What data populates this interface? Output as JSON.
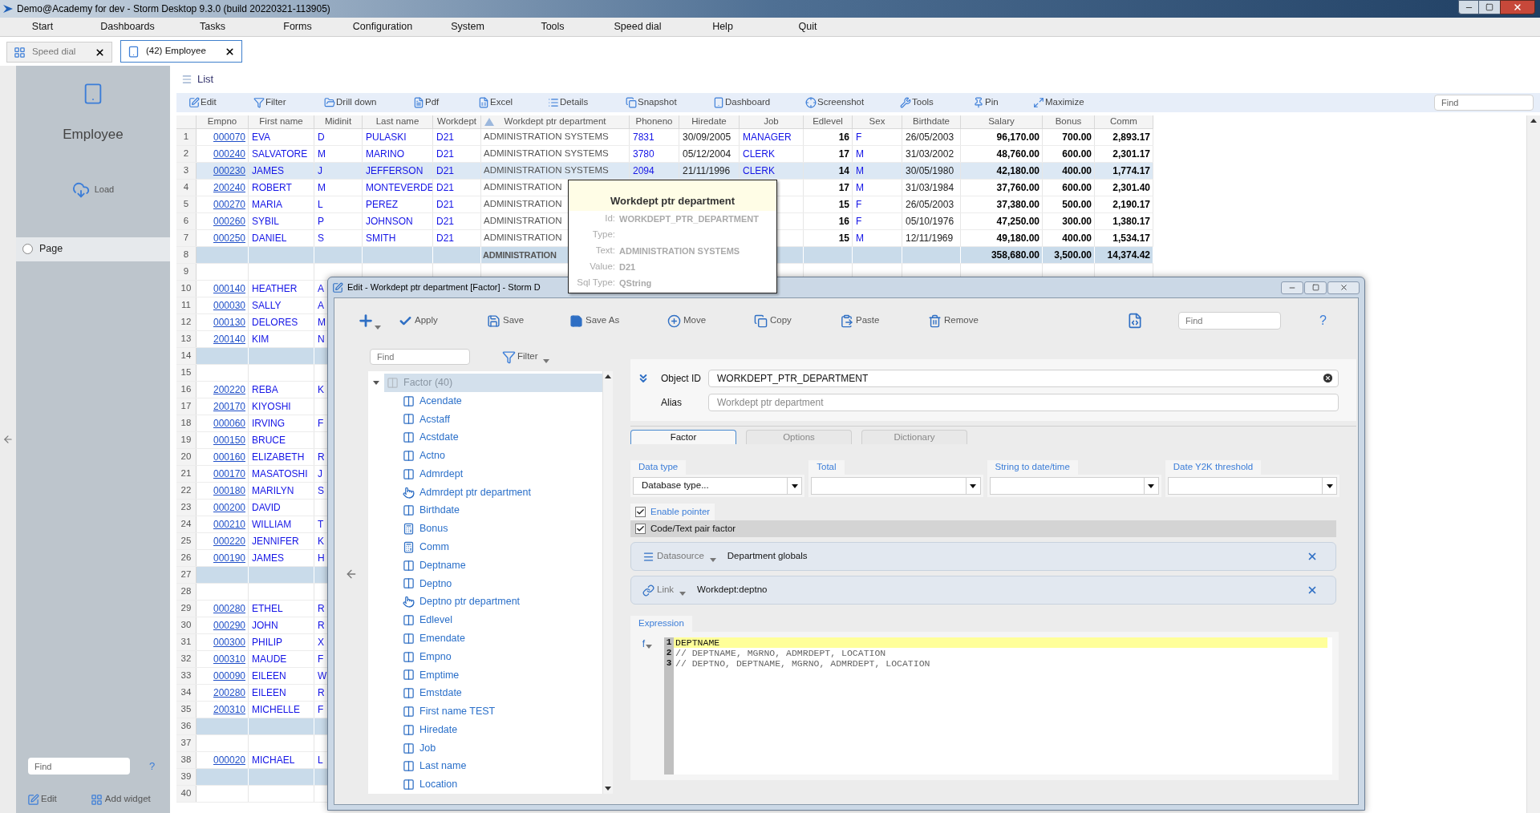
{
  "window": {
    "title": "Demo@Academy for dev -  Storm Desktop 9.3.0 (build 20220321-113905)"
  },
  "menu": [
    "Start",
    "Dashboards",
    "Tasks",
    "Forms",
    "Configuration",
    "System",
    "Tools",
    "Speed dial",
    "Help",
    "Quit"
  ],
  "tabs": [
    {
      "label": "Speed dial",
      "selected": false
    },
    {
      "label": "(42) Employee",
      "selected": true
    }
  ],
  "sidebar": {
    "title": "Employee",
    "load": "Load",
    "items": [
      {
        "label": "Page",
        "selected": false
      }
    ],
    "find_placeholder": "Find",
    "help": "?",
    "actions": [
      "Edit",
      "Add widget"
    ]
  },
  "list": {
    "title": "List",
    "toolbar": [
      "Edit",
      "Filter",
      "Drill down",
      "Pdf",
      "Excel",
      "Details",
      "Snapshot",
      "Dashboard",
      "Screenshot",
      "Tools",
      "Pin",
      "Maximize"
    ],
    "find_placeholder": "Find"
  },
  "table": {
    "columns": [
      {
        "label": "Empno",
        "sorted": false
      },
      {
        "label": "First name",
        "sorted": false
      },
      {
        "label": "Midinit",
        "sorted": false
      },
      {
        "label": "Last name",
        "sorted": false
      },
      {
        "label": "Workdept",
        "sorted": false
      },
      {
        "label": "Workdept ptr department",
        "sorted": true
      },
      {
        "label": "Phoneno",
        "sorted": false
      },
      {
        "label": "Hiredate",
        "sorted": false
      },
      {
        "label": "Job",
        "sorted": false
      },
      {
        "label": "Edlevel",
        "sorted": false
      },
      {
        "label": "Sex",
        "sorted": false
      },
      {
        "label": "Birthdate",
        "sorted": false
      },
      {
        "label": "Salary",
        "sorted": false
      },
      {
        "label": "Bonus",
        "sorted": false
      },
      {
        "label": "Comm",
        "sorted": false
      }
    ],
    "rows": [
      {
        "num": "1",
        "kind": "data",
        "selected": false,
        "cells": {
          "empno": "000070",
          "first_name": "EVA",
          "midinit": "D",
          "last_name": "PULASKI",
          "workdept": "D21",
          "ptr_dept": "ADMINISTRATION SYSTEMS",
          "phoneno": "7831",
          "hiredate": "30/09/2005",
          "job": "MANAGER",
          "edlevel": "16",
          "sex": "F",
          "birthdate": "26/05/2003",
          "salary": "96,170.00",
          "bonus": "700.00",
          "comm": "2,893.17"
        }
      },
      {
        "num": "2",
        "kind": "data",
        "selected": false,
        "cells": {
          "empno": "000240",
          "first_name": "SALVATORE",
          "midinit": "M",
          "last_name": "MARINO",
          "workdept": "D21",
          "ptr_dept": "ADMINISTRATION SYSTEMS",
          "phoneno": "3780",
          "hiredate": "05/12/2004",
          "job": "CLERK",
          "edlevel": "17",
          "sex": "M",
          "birthdate": "31/03/2002",
          "salary": "48,760.00",
          "bonus": "600.00",
          "comm": "2,301.17"
        }
      },
      {
        "num": "3",
        "kind": "data",
        "selected": true,
        "cells": {
          "empno": "000230",
          "first_name": "JAMES",
          "midinit": "J",
          "last_name": "JEFFERSON",
          "workdept": "D21",
          "ptr_dept": "ADMINISTRATION SYSTEMS",
          "phoneno": "2094",
          "hiredate": "21/11/1996",
          "job": "CLERK",
          "edlevel": "14",
          "sex": "M",
          "birthdate": "30/05/1980",
          "salary": "42,180.00",
          "bonus": "400.00",
          "comm": "1,774.17"
        }
      },
      {
        "num": "4",
        "kind": "data",
        "selected": false,
        "cells": {
          "empno": "200240",
          "first_name": "ROBERT",
          "midinit": "M",
          "last_name": "MONTEVERDE",
          "workdept": "D21",
          "ptr_dept": "ADMINISTRATION",
          "edlevel": "17",
          "sex": "M",
          "birthdate": "31/03/1984",
          "salary": "37,760.00",
          "bonus": "600.00",
          "comm": "2,301.40"
        }
      },
      {
        "num": "5",
        "kind": "data",
        "selected": false,
        "cells": {
          "empno": "000270",
          "first_name": "MARIA",
          "midinit": "L",
          "last_name": "PEREZ",
          "workdept": "D21",
          "ptr_dept": "ADMINISTRATION",
          "edlevel": "15",
          "sex": "F",
          "birthdate": "26/05/2003",
          "salary": "37,380.00",
          "bonus": "500.00",
          "comm": "2,190.17"
        }
      },
      {
        "num": "6",
        "kind": "data",
        "selected": false,
        "cells": {
          "empno": "000260",
          "first_name": "SYBIL",
          "midinit": "P",
          "last_name": "JOHNSON",
          "workdept": "D21",
          "ptr_dept": "ADMINISTRATION",
          "edlevel": "16",
          "sex": "F",
          "birthdate": "05/10/1976",
          "salary": "47,250.00",
          "bonus": "300.00",
          "comm": "1,380.17"
        }
      },
      {
        "num": "7",
        "kind": "data",
        "selected": false,
        "cells": {
          "empno": "000250",
          "first_name": "DANIEL",
          "midinit": "S",
          "last_name": "SMITH",
          "workdept": "D21",
          "ptr_dept": "ADMINISTRATION",
          "edlevel": "15",
          "sex": "M",
          "birthdate": "12/11/1969",
          "salary": "49,180.00",
          "bonus": "400.00",
          "comm": "1,534.17"
        }
      },
      {
        "num": "8",
        "kind": "group",
        "selected": false,
        "cells": {
          "ptr_dept": "ADMINISTRATION",
          "salary": "358,680.00",
          "bonus": "3,500.00",
          "comm": "14,374.42"
        }
      },
      {
        "num": "9",
        "kind": "blank",
        "selected": false
      },
      {
        "num": "10",
        "kind": "data",
        "selected": false,
        "cells": {
          "empno": "000140",
          "first_name": "HEATHER",
          "midinit": "A"
        }
      },
      {
        "num": "11",
        "kind": "data",
        "selected": false,
        "cells": {
          "empno": "000030",
          "first_name": "SALLY",
          "midinit": "A"
        }
      },
      {
        "num": "12",
        "kind": "data",
        "selected": false,
        "cells": {
          "empno": "000130",
          "first_name": "DELORES",
          "midinit": "M"
        }
      },
      {
        "num": "13",
        "kind": "data",
        "selected": false,
        "cells": {
          "empno": "200140",
          "first_name": "KIM",
          "midinit": "N"
        }
      },
      {
        "num": "14",
        "kind": "group",
        "selected": false
      },
      {
        "num": "15",
        "kind": "blank",
        "selected": false
      },
      {
        "num": "16",
        "kind": "data",
        "selected": false,
        "cells": {
          "empno": "200220",
          "first_name": "REBA",
          "midinit": "K"
        }
      },
      {
        "num": "17",
        "kind": "data",
        "selected": false,
        "cells": {
          "empno": "200170",
          "first_name": "KIYOSHI"
        }
      },
      {
        "num": "18",
        "kind": "data",
        "selected": false,
        "cells": {
          "empno": "000060",
          "first_name": "IRVING",
          "midinit": "F"
        }
      },
      {
        "num": "19",
        "kind": "data",
        "selected": false,
        "cells": {
          "empno": "000150",
          "first_name": "BRUCE"
        }
      },
      {
        "num": "20",
        "kind": "data",
        "selected": false,
        "cells": {
          "empno": "000160",
          "first_name": "ELIZABETH",
          "midinit": "R"
        }
      },
      {
        "num": "21",
        "kind": "data",
        "selected": false,
        "cells": {
          "empno": "000170",
          "first_name": "MASATOSHI",
          "midinit": "J"
        }
      },
      {
        "num": "22",
        "kind": "data",
        "selected": false,
        "cells": {
          "empno": "000180",
          "first_name": "MARILYN",
          "midinit": "S"
        }
      },
      {
        "num": "23",
        "kind": "data",
        "selected": false,
        "cells": {
          "empno": "000200",
          "first_name": "DAVID"
        }
      },
      {
        "num": "24",
        "kind": "data",
        "selected": false,
        "cells": {
          "empno": "000210",
          "first_name": "WILLIAM",
          "midinit": "T"
        }
      },
      {
        "num": "25",
        "kind": "data",
        "selected": false,
        "cells": {
          "empno": "000220",
          "first_name": "JENNIFER",
          "midinit": "K"
        }
      },
      {
        "num": "26",
        "kind": "data",
        "selected": false,
        "cells": {
          "empno": "000190",
          "first_name": "JAMES",
          "midinit": "H"
        }
      },
      {
        "num": "27",
        "kind": "group",
        "selected": false
      },
      {
        "num": "28",
        "kind": "blank",
        "selected": false
      },
      {
        "num": "29",
        "kind": "data",
        "selected": false,
        "cells": {
          "empno": "000280",
          "first_name": "ETHEL",
          "midinit": "R"
        }
      },
      {
        "num": "30",
        "kind": "data",
        "selected": false,
        "cells": {
          "empno": "000290",
          "first_name": "JOHN",
          "midinit": "R"
        }
      },
      {
        "num": "31",
        "kind": "data",
        "selected": false,
        "cells": {
          "empno": "000300",
          "first_name": "PHILIP",
          "midinit": "X"
        }
      },
      {
        "num": "32",
        "kind": "data",
        "selected": false,
        "cells": {
          "empno": "000310",
          "first_name": "MAUDE",
          "midinit": "F"
        }
      },
      {
        "num": "33",
        "kind": "data",
        "selected": false,
        "cells": {
          "empno": "000090",
          "first_name": "EILEEN",
          "midinit": "W"
        }
      },
      {
        "num": "34",
        "kind": "data",
        "selected": false,
        "cells": {
          "empno": "200280",
          "first_name": "EILEEN",
          "midinit": "R"
        }
      },
      {
        "num": "35",
        "kind": "data",
        "selected": false,
        "cells": {
          "empno": "200310",
          "first_name": "MICHELLE",
          "midinit": "F"
        }
      },
      {
        "num": "36",
        "kind": "group",
        "selected": false
      },
      {
        "num": "37",
        "kind": "blank",
        "selected": false
      },
      {
        "num": "38",
        "kind": "data",
        "selected": false,
        "cells": {
          "empno": "000020",
          "first_name": "MICHAEL",
          "midinit": "L"
        }
      },
      {
        "num": "39",
        "kind": "group",
        "selected": false
      },
      {
        "num": "40",
        "kind": "blank",
        "selected": false
      }
    ]
  },
  "tooltip": {
    "title": "Workdept ptr department",
    "fields": [
      {
        "label": "Id:",
        "value": "WORKDEPT_PTR_DEPARTMENT"
      },
      {
        "label": "Type:"
      },
      {
        "label": "Text:",
        "value": "ADMINISTRATION SYSTEMS"
      },
      {
        "label": "Value:",
        "value": "D21"
      },
      {
        "label": "Sql Type:",
        "value": "QString"
      }
    ]
  },
  "dialog": {
    "title": "Edit - Workdept ptr department [Factor] -  Storm D",
    "toolbar": [
      "Apply",
      "Save",
      "Save As",
      "Move",
      "Copy",
      "Paste",
      "Remove"
    ],
    "find_placeholder": "Find",
    "help": "?",
    "tree": {
      "find_placeholder": "Find",
      "filter": "Filter",
      "root": {
        "label": "Factor (40)",
        "expanded": true,
        "selected": true,
        "children": [
          {
            "label": "Acendate",
            "kind": "column"
          },
          {
            "label": "Acstaff",
            "kind": "column"
          },
          {
            "label": "Acstdate",
            "kind": "column"
          },
          {
            "label": "Actno",
            "kind": "column"
          },
          {
            "label": "Admrdept",
            "kind": "column"
          },
          {
            "label": "Admrdept ptr department",
            "kind": "pointer"
          },
          {
            "label": "Birthdate",
            "kind": "column"
          },
          {
            "label": "Bonus",
            "kind": "calc"
          },
          {
            "label": "Comm",
            "kind": "calc"
          },
          {
            "label": "Deptname",
            "kind": "column"
          },
          {
            "label": "Deptno",
            "kind": "column"
          },
          {
            "label": "Deptno ptr department",
            "kind": "pointer"
          },
          {
            "label": "Edlevel",
            "kind": "column"
          },
          {
            "label": "Emendate",
            "kind": "column"
          },
          {
            "label": "Empno",
            "kind": "column"
          },
          {
            "label": "Emptime",
            "kind": "column"
          },
          {
            "label": "Emstdate",
            "kind": "column"
          },
          {
            "label": "First name TEST",
            "kind": "column"
          },
          {
            "label": "Hiredate",
            "kind": "column"
          },
          {
            "label": "Job",
            "kind": "column"
          },
          {
            "label": "Last name",
            "kind": "column"
          },
          {
            "label": "Location",
            "kind": "column"
          }
        ]
      }
    },
    "form": {
      "object_id": {
        "label": "Object ID",
        "value": "WORKDEPT_PTR_DEPARTMENT"
      },
      "alias": {
        "label": "Alias",
        "placeholder": "Workdept ptr department"
      },
      "tabs": [
        {
          "label": "Factor",
          "selected": true
        },
        {
          "label": "Options",
          "selected": false
        },
        {
          "label": "Dictionary",
          "selected": false
        }
      ],
      "fields": [
        {
          "label": "Data type",
          "value": "Database type..."
        },
        {
          "label": "Total"
        },
        {
          "label": "String to date/time"
        },
        {
          "label": "Date Y2K threshold"
        }
      ],
      "checks": [
        {
          "label": "Enable pointer",
          "checked": true
        },
        {
          "label": "Code/Text pair factor",
          "checked": true
        }
      ],
      "links": [
        {
          "label": "Datasource",
          "value": "Department globals"
        },
        {
          "label": "Link",
          "value": "Workdept:deptno"
        }
      ],
      "expression": {
        "label": "Expression",
        "function_button": "f",
        "lines": [
          {
            "num": "1",
            "text": "DEPTNAME",
            "highlighted": true
          },
          {
            "num": "2",
            "text": "// DEPTNAME, MGRNO, ADMRDEPT, LOCATION",
            "highlighted": false
          },
          {
            "num": "3",
            "text": "// DEPTNO, DEPTNAME, MGRNO, ADMRDEPT, LOCATION",
            "highlighted": false
          }
        ]
      }
    }
  }
}
